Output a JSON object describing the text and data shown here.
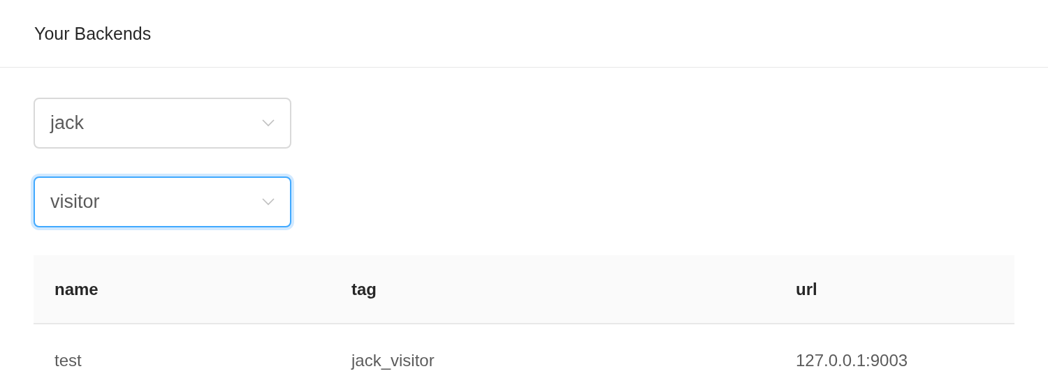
{
  "header": {
    "title": "Your Backends"
  },
  "selects": [
    {
      "value": "jack",
      "focused": false
    },
    {
      "value": "visitor",
      "focused": true
    }
  ],
  "table": {
    "columns": [
      "name",
      "tag",
      "url"
    ],
    "rows": [
      [
        "test",
        "jack_visitor",
        "127.0.0.1:9003"
      ]
    ]
  }
}
